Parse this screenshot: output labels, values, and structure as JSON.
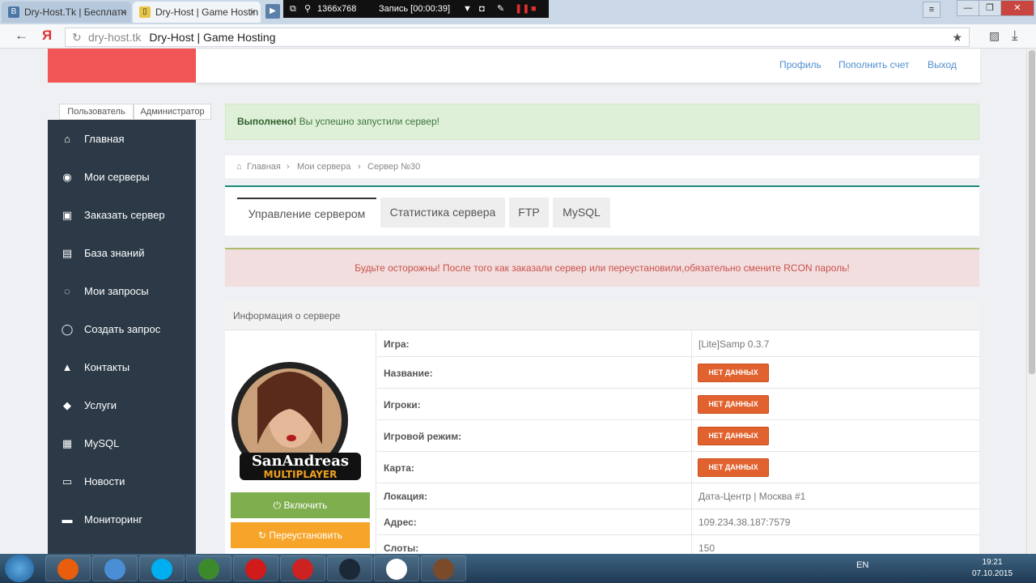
{
  "browser": {
    "tabs": [
      {
        "icon": "vk-icon",
        "label": "Dry-Host.Tk | Бесплатн"
      },
      {
        "icon": "dh-icon",
        "label": "Dry-Host | Game Hostin"
      }
    ],
    "url_domain": "dry-host.tk",
    "url_title": "Dry-Host | Game Hosting"
  },
  "recorder": {
    "resolution": "1366x768",
    "status": "Запись [00:00:39]"
  },
  "header": {
    "links": [
      "Профиль",
      "Пополнить счет",
      "Выход"
    ]
  },
  "role_tabs": [
    "Пользователь",
    "Администратор"
  ],
  "sidebar": {
    "items": [
      {
        "icon": "home-icon",
        "glyph": "⌂",
        "label": "Главная"
      },
      {
        "icon": "gamepad-icon",
        "glyph": "◉",
        "label": "Мои серверы"
      },
      {
        "icon": "cart-icon",
        "glyph": "▣",
        "label": "Заказать сервер"
      },
      {
        "icon": "book-icon",
        "glyph": "▤",
        "label": "База знаний"
      },
      {
        "icon": "comments-icon",
        "glyph": "◌",
        "label": "Мои запросы"
      },
      {
        "icon": "comment-icon",
        "glyph": "◯",
        "label": "Создать запрос"
      },
      {
        "icon": "bell-icon",
        "glyph": "▲",
        "label": "Контакты"
      },
      {
        "icon": "cubes-icon",
        "glyph": "◆",
        "label": "Услуги"
      },
      {
        "icon": "database-icon",
        "glyph": "▦",
        "label": "MySQL"
      },
      {
        "icon": "newspaper-icon",
        "glyph": "▭",
        "label": "Новости"
      },
      {
        "icon": "desktop-icon",
        "glyph": "▬",
        "label": "Мониторинг"
      }
    ]
  },
  "alert_success": {
    "strong": "Выполнено!",
    "text": " Вы успешно запустили сервер!"
  },
  "breadcrumb": [
    "Главная",
    "Мои сервера",
    "Сервер №30"
  ],
  "server_tabs": [
    "Управление сервером",
    "Статистика сервера",
    "FTP",
    "MySQL"
  ],
  "alert_warning": "Будьте осторожны! После того как заказали сервер или переустановили,обязательно смените RCON пароль!",
  "info": {
    "title": "Информация о сервере",
    "logo_line1": "SanAndreas",
    "logo_line2": "MULTIPLAYER",
    "rows": [
      {
        "label": "Игра:",
        "value": "[Lite]Samp 0.3.7"
      },
      {
        "label": "Название:",
        "badge": "НЕТ ДАННЫХ"
      },
      {
        "label": "Игроки:",
        "badge": "НЕТ ДАННЫХ"
      },
      {
        "label": "Игровой режим:",
        "badge": "НЕТ ДАННЫХ"
      },
      {
        "label": "Карта:",
        "badge": "НЕТ ДАННЫХ"
      },
      {
        "label": "Локация:",
        "value": "Дата-Центр | Москва #1"
      },
      {
        "label": "Адрес:",
        "value": "109.234.38.187:7579"
      },
      {
        "label": "Слоты:",
        "value": "150"
      }
    ],
    "btn_on": "Включить",
    "btn_reinstall": "Переустановить"
  },
  "taskbar": {
    "lang": "EN",
    "time": "19:21",
    "date": "07.10.2015"
  },
  "colors": {
    "sidebar": "#2c3a47",
    "logo": "#f25555",
    "badge": "#e2622f",
    "green": "#7fae4f",
    "orange": "#f7a52a"
  }
}
